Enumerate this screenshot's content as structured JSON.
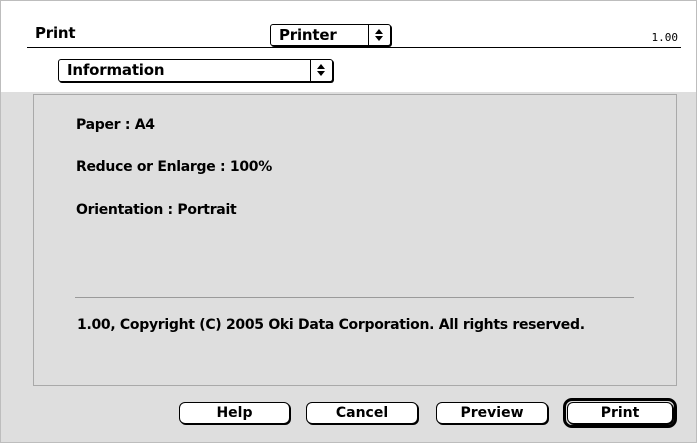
{
  "dialog": {
    "title": "Print",
    "version": "1.00",
    "printer_popup": "Printer",
    "panel_popup": "Information"
  },
  "information": {
    "paper": "Paper : A4",
    "reduce_enlarge": "Reduce or Enlarge : 100%",
    "orientation": "Orientation : Portrait",
    "copyright": "1.00, Copyright (C) 2005 Oki Data Corporation. All rights reserved."
  },
  "buttons": {
    "help": "Help",
    "cancel": "Cancel",
    "preview": "Preview",
    "print": "Print"
  },
  "colors": {
    "dialog_background": "#dedede",
    "header_background": "#ffffff"
  }
}
